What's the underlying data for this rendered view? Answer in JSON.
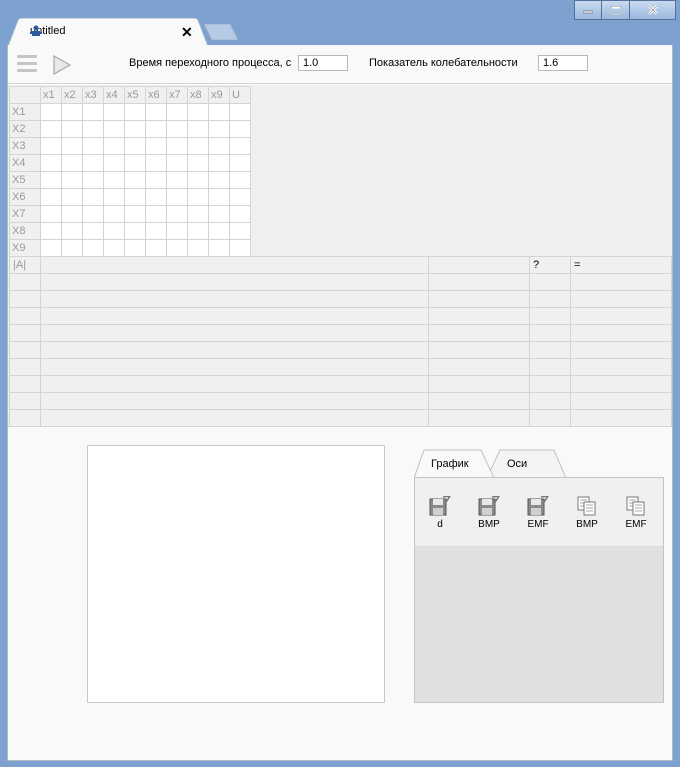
{
  "tab": {
    "title": "untitled",
    "close": "✕"
  },
  "toolbar": {
    "time_label": "Время переходного процесса, с",
    "time_value": "1.0",
    "osc_label": "Показатель колебательности",
    "osc_value": "1.6"
  },
  "matrix": {
    "col_headers": [
      "x1",
      "x2",
      "x3",
      "x4",
      "x5",
      "x6",
      "x7",
      "x8",
      "x9",
      "U"
    ],
    "row_headers": [
      "X1",
      "X2",
      "X3",
      "X4",
      "X5",
      "X6",
      "X7",
      "X8",
      "X9"
    ]
  },
  "results": {
    "headers": [
      "|A|",
      "",
      "",
      "?",
      "="
    ],
    "row_count": 9
  },
  "side_tabs": [
    "График",
    "Оси"
  ],
  "panel_buttons": [
    {
      "icon": "save-icon",
      "label": "d"
    },
    {
      "icon": "save-icon",
      "label": "BMP"
    },
    {
      "icon": "save-icon",
      "label": "EMF"
    },
    {
      "icon": "copy-icon",
      "label": "BMP"
    },
    {
      "icon": "copy-icon",
      "label": "EMF"
    }
  ]
}
